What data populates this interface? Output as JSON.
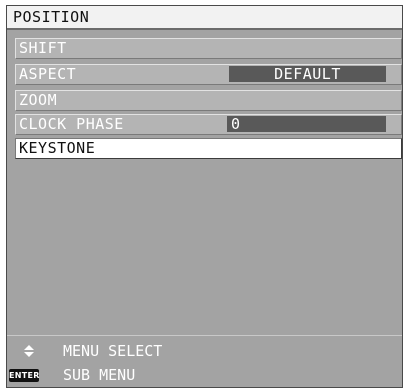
{
  "osd": {
    "title": "POSITION",
    "menu": [
      {
        "label": "SHIFT",
        "value": ""
      },
      {
        "label": "ASPECT",
        "value": "DEFAULT"
      },
      {
        "label": "ZOOM",
        "value": ""
      },
      {
        "label": "CLOCK PHASE",
        "value": "0"
      },
      {
        "label": "KEYSTONE",
        "value": "",
        "selected": true
      }
    ],
    "footer": {
      "select_icon": "up-down-arrows-icon",
      "select_label": "MENU SELECT",
      "enter_icon_text": "ENTER",
      "submenu_label": "SUB MENU"
    }
  },
  "colors": {
    "panel": "#a3a3a3",
    "item": "#b4b4b4",
    "item_selected": "#ffffff",
    "value_box": "#595959",
    "title_bar": "#f2f2f2"
  }
}
